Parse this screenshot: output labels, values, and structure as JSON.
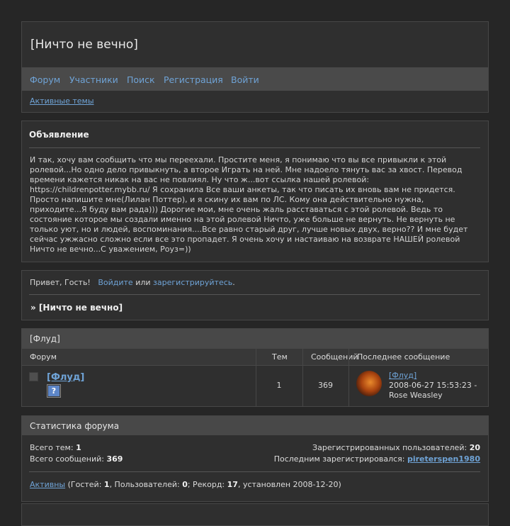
{
  "header": {
    "title": "[Ничто не вечно]",
    "nav": [
      "Форум",
      "Участники",
      "Поиск",
      "Регистрация",
      "Войти"
    ],
    "active_topics": "Активные темы"
  },
  "announcement": {
    "heading": "Объявление",
    "text": "И так, хочу вам сообщить что мы переехали. Простите меня, я понимаю что вы все привыкли к этой ролевой...Но одно дело привыкнуть, а второе Играть на ней. Мне надоело тянуть вас за хвост. Перевод времени кажется никак на вас не повлиял. Ну что ж...вот ссылка нашей ролевой: https://childrenpotter.mybb.ru/ Я сохранила Все ваши анкеты, так что писать их вновь вам не придется. Просто напишите мне(Лилан Поттер), и я скину их вам по ЛС. Кому она действительно нужна, приходите...Я буду вам рада))) Дорогие мои, мне очень жаль расставаться с этой ролевой. Ведь то состояние которое мы создали именно на этой ролевой Ничто, уже больше не вернуть. Не вернуть не только уют, но и людей, воспоминания....Все равно старый друг, лучше новых двух, верно?? И мне будет сейчас ужжасно сложно если все это пропадет. Я очень хочу и настаиваю на возврате НАШЕЙ ролевой Ничто не вечно...С уважением, Роуз=))"
  },
  "welcome": {
    "greeting": "Привет, Гость!",
    "login_link": "Войдите",
    "or": "или",
    "register_link": "зарегистрируйтесь",
    "period": ".",
    "crumb": "» [Ничто не вечно]"
  },
  "forum": {
    "category": "[Флуд]",
    "columns": {
      "forum": "Форум",
      "topics": "Тем",
      "posts": "Сообщений",
      "last": "Последнее сообщение"
    },
    "rows": [
      {
        "name": "[Флуд]",
        "topics": "1",
        "posts": "369",
        "last_link": "[Флуд]",
        "last_date": "2008-06-27 15:53:23 -",
        "last_author": "Rose Weasley"
      }
    ]
  },
  "stats": {
    "title": "Статистика форума",
    "total_topics_label": "Всего тем:",
    "total_topics": "1",
    "total_posts_label": "Всего сообщений:",
    "total_posts": "369",
    "registered_label": "Зарегистрированных пользователей:",
    "registered": "20",
    "last_registered_label": "Последним зарегистрировался:",
    "last_registered": "pireterspen1980",
    "active_link": "Активны",
    "guests_label": "(Гостей:",
    "guests": "1",
    "users_label": ", Пользователей:",
    "users": "0",
    "record_label": "; Рекорд:",
    "record": "17",
    "record_date": ", установлен 2008-12-20)"
  },
  "icons": {
    "forum_status": "forum-status-icon",
    "question": "question-icon",
    "avatar": "user-avatar"
  }
}
